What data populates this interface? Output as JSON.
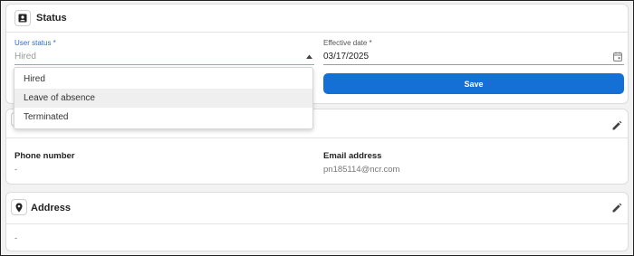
{
  "status_card": {
    "title": "Status",
    "user_status": {
      "label": "User status *",
      "placeholder": "Hired",
      "options": [
        "Hired",
        "Leave of absence",
        "Terminated"
      ],
      "hovered_option": "Leave of absence"
    },
    "effective_date": {
      "label": "Effective date *",
      "value": "03/17/2025"
    },
    "save_label": "Save"
  },
  "contact_card": {
    "phone": {
      "label": "Phone number",
      "value": "-"
    },
    "email": {
      "label": "Email address",
      "value": "pn185114@ncr.com"
    }
  },
  "address_card": {
    "title": "Address",
    "value": "-"
  },
  "colors": {
    "accent": "#1570d6",
    "label_accent": "#2b6fd0"
  },
  "icons": [
    "contact-card-icon",
    "calendar-icon",
    "caret-up-icon",
    "pencil-icon",
    "map-pin-icon"
  ]
}
